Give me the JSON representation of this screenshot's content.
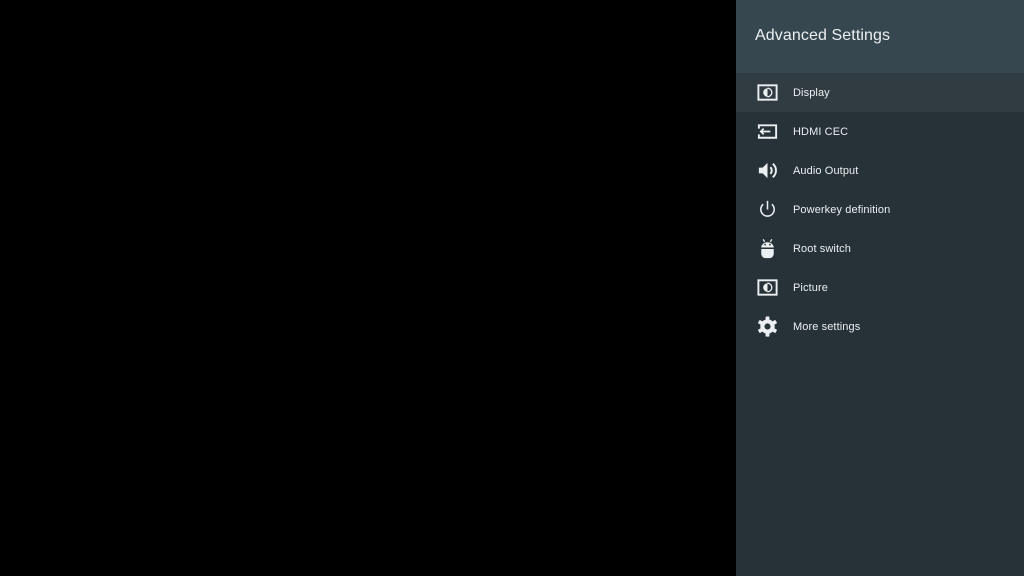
{
  "panel": {
    "title": "Advanced Settings",
    "items": [
      {
        "label": "Display",
        "icon": "display-icon",
        "focused": true
      },
      {
        "label": "HDMI CEC",
        "icon": "hdmi-input-icon",
        "focused": false
      },
      {
        "label": "Audio Output",
        "icon": "volume-icon",
        "focused": false
      },
      {
        "label": "Powerkey definition",
        "icon": "power-icon",
        "focused": false
      },
      {
        "label": "Root switch",
        "icon": "android-icon",
        "focused": false
      },
      {
        "label": "Picture",
        "icon": "picture-icon",
        "focused": false
      },
      {
        "label": "More settings",
        "icon": "gear-icon",
        "focused": false
      }
    ]
  },
  "colors": {
    "background": "#000000",
    "panel": "#263238",
    "header": "#37474f",
    "focused_row": "#303c42",
    "text": "#eceff1"
  }
}
